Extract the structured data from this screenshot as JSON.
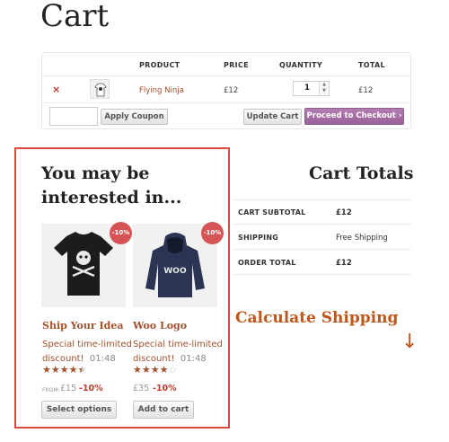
{
  "page": {
    "title": "Cart"
  },
  "cart": {
    "headers": {
      "product": "PRODUCT",
      "price": "PRICE",
      "quantity": "QUANTITY",
      "total": "TOTAL"
    },
    "item": {
      "remove": "×",
      "name": "Flying Ninja",
      "price": "£12",
      "quantity": "1",
      "total": "£12"
    },
    "coupon_placeholder": "",
    "apply_coupon": "Apply Coupon",
    "update_cart": "Update Cart",
    "checkout": "Proceed to Checkout ›"
  },
  "upsell": {
    "title": "You may be interested in...",
    "products": [
      {
        "name": "Ship Your Idea",
        "badge": "-10%",
        "promo": "Special time-limited",
        "promo2": "discount!",
        "time": "01:48",
        "rating": 4.5,
        "from": "FROM:",
        "price": "£15",
        "discount": "-10%",
        "button": "Select options"
      },
      {
        "name": "Woo Logo",
        "badge": "-10%",
        "promo": "Special time-limited",
        "promo2": "discount!",
        "time": "01:48",
        "rating": 4,
        "from": "",
        "price": "£35",
        "discount": "-10%",
        "button": "Add to cart"
      }
    ]
  },
  "totals": {
    "title": "Cart Totals",
    "rows": [
      {
        "label": "CART SUBTOTAL",
        "value": "£12"
      },
      {
        "label": "SHIPPING",
        "value": "Free Shipping"
      },
      {
        "label": "ORDER TOTAL",
        "value": "£12"
      }
    ]
  },
  "callout": {
    "text": "Calculate Shipping",
    "arrow": "↓"
  },
  "colors": {
    "accent": "#a0522d",
    "checkout": "#9b629a",
    "highlight_border": "#d9493e",
    "badge": "#d65455"
  }
}
